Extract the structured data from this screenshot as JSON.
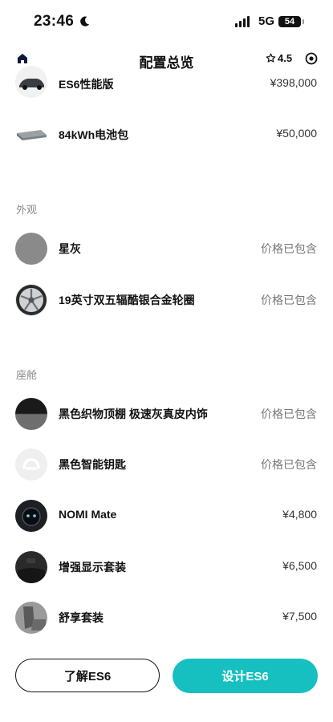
{
  "status": {
    "time": "23:46",
    "network": "5G",
    "battery": "54"
  },
  "nav": {
    "title": "配置总览",
    "rating": "4.5"
  },
  "items_top": [
    {
      "label": "ES6性能版",
      "price": "¥398,000",
      "thumb": "car-thumb"
    },
    {
      "label": "84kWh电池包",
      "price": "¥50,000",
      "thumb": "battery-pack-thumb"
    }
  ],
  "exterior": {
    "title": "外观",
    "items": [
      {
        "label": "星灰",
        "price": "价格已包含",
        "thumb": "paint-swatch-thumb",
        "color": "#8a8a8a"
      },
      {
        "label": "19英寸双五辐酷银合金轮圈",
        "price": "价格已包含",
        "thumb": "wheel-thumb"
      }
    ]
  },
  "cabin": {
    "title": "座舱",
    "items": [
      {
        "label": "黑色织物顶棚 极速灰真皮内饰",
        "price": "价格已包含",
        "thumb": "interior-swatch-thumb"
      },
      {
        "label": "黑色智能钥匙",
        "price": "价格已包含",
        "thumb": "key-thumb"
      },
      {
        "label": "NOMI Mate",
        "price": "¥4,800",
        "thumb": "nomi-thumb"
      },
      {
        "label": "增强显示套装",
        "price": "¥6,500",
        "thumb": "display-thumb"
      },
      {
        "label": "舒享套装",
        "price": "¥7,500",
        "thumb": "seat-thumb"
      }
    ]
  },
  "buttons": {
    "learn": "了解ES6",
    "design": "设计ES6"
  },
  "colors": {
    "accent": "#16bfc0",
    "muted": "#888888"
  }
}
